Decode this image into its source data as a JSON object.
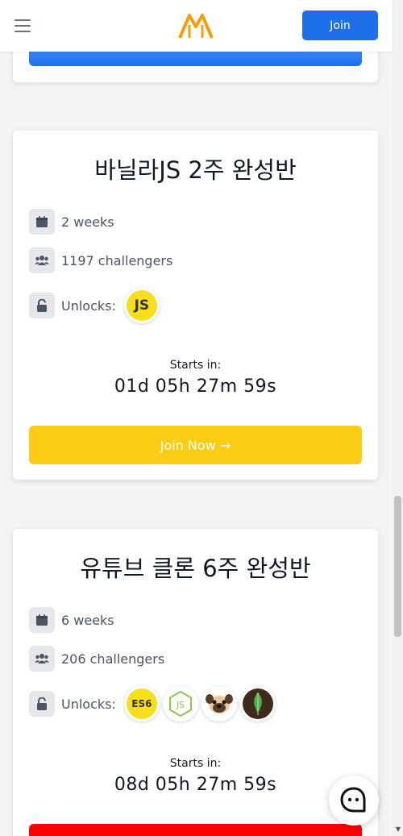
{
  "nav": {
    "join_label": "Join"
  },
  "colors": {
    "primary": "#1f6feb",
    "yellow": "#facc15",
    "red": "#ff0000",
    "logo": "#f59e0b"
  },
  "courses": [
    {
      "title": "바닐라JS 2주 완성반",
      "duration": "2 weeks",
      "challengers": "1197 challengers",
      "unlocks_label": "Unlocks:",
      "unlocks": [
        "JS"
      ],
      "starts_label": "Starts in:",
      "countdown": "01d 05h 27m 59s",
      "join_label": "Join Now →"
    },
    {
      "title": "유튜브 클론 6주 완성반",
      "duration": "6 weeks",
      "challengers": "206 challengers",
      "unlocks_label": "Unlocks:",
      "unlocks": [
        "ES6",
        "nodejs-icon",
        "pug-icon",
        "mongodb-icon"
      ],
      "starts_label": "Starts in:",
      "countdown": "08d 05h 27m 59s",
      "join_label": ""
    }
  ]
}
